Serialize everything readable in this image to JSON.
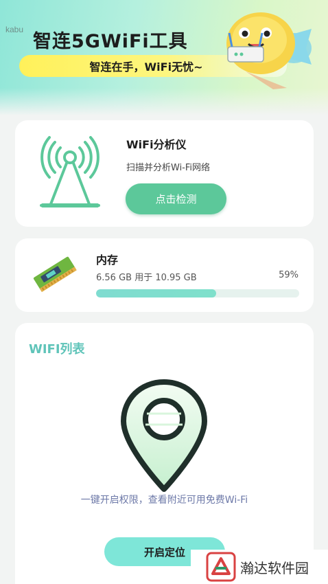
{
  "header": {
    "corner_label": "kabu",
    "title": "智连5GWiFi工具",
    "slogan": "智连在手，WiFi无忧~"
  },
  "analyzer_card": {
    "title": "WiFi分析仪",
    "description": "扫描并分析Wi-Fi网络",
    "button_label": "点击检测",
    "icon": "wifi-tower-icon"
  },
  "memory_card": {
    "title": "内存",
    "usage_text": "6.56 GB 用于 10.95 GB",
    "percent_text": "59%",
    "used_fraction": 0.59,
    "icon": "memory-chip-icon"
  },
  "wifi_card": {
    "title": "WIFI列表",
    "permission_text": "一键开启权限，查看附近可用免费Wi-Fi",
    "button_label": "开启定位",
    "icon": "location-pin-icon"
  },
  "watermark": {
    "text": "瀚达软件园"
  },
  "colors": {
    "accent_green": "#5cc89a",
    "teal": "#7ee6d8",
    "wifi_title": "#5fc4b9",
    "permission_text": "#6d79a8"
  }
}
